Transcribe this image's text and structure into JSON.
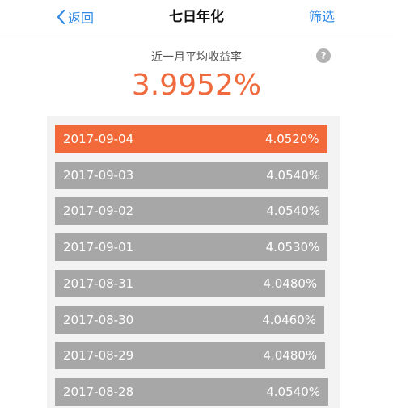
{
  "nav": {
    "back_label": "返回",
    "title": "七日年化",
    "filter_label": "筛选"
  },
  "summary": {
    "label": "近一月平均收益率",
    "value": "3.9952%",
    "help_icon": "?"
  },
  "colors": {
    "accent": "#2f8be6",
    "highlight": "#f26a3a",
    "bar": "#a7a7a7"
  },
  "records": [
    {
      "date": "2017-09-04",
      "rate": "4.0520%",
      "value": 4.052,
      "selected": true
    },
    {
      "date": "2017-09-03",
      "rate": "4.0540%",
      "value": 4.054,
      "selected": false
    },
    {
      "date": "2017-09-02",
      "rate": "4.0540%",
      "value": 4.054,
      "selected": false
    },
    {
      "date": "2017-09-01",
      "rate": "4.0530%",
      "value": 4.053,
      "selected": false
    },
    {
      "date": "2017-08-31",
      "rate": "4.0480%",
      "value": 4.048,
      "selected": false
    },
    {
      "date": "2017-08-30",
      "rate": "4.0460%",
      "value": 4.046,
      "selected": false
    },
    {
      "date": "2017-08-29",
      "rate": "4.0480%",
      "value": 4.048,
      "selected": false
    },
    {
      "date": "2017-08-28",
      "rate": "4.0540%",
      "value": 4.054,
      "selected": false
    }
  ]
}
